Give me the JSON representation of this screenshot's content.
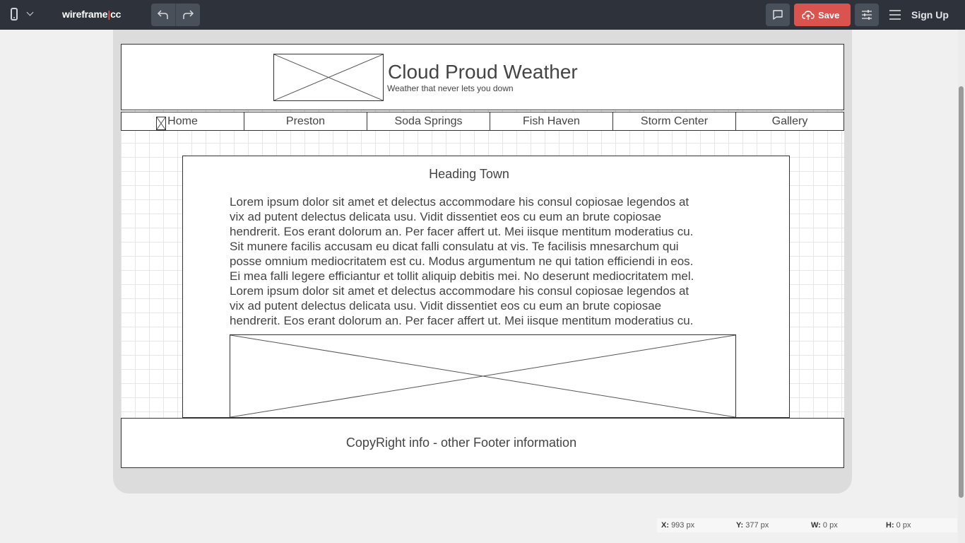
{
  "toolbar": {
    "device_icon": "phone-icon",
    "logo_main": "wireframe",
    "logo_pipe": "|",
    "logo_suffix": "cc",
    "undo_icon": "undo-icon",
    "redo_icon": "redo-icon",
    "comment_icon": "comment-icon",
    "save_label": "Save",
    "save_icon": "cloud-upload-icon",
    "settings_icon": "sliders-icon",
    "menu_icon": "hamburger-icon",
    "signup_label": "Sign Up",
    "colors": {
      "bar": "#2d323b",
      "save": "#d9534f",
      "button": "#4a505a"
    }
  },
  "wireframe": {
    "site_title": "Cloud Proud Weather",
    "tagline": "Weather that never lets you down",
    "nav": [
      "Home",
      "Preston",
      "Soda Springs",
      "Fish Haven",
      "Storm Center",
      "Gallery"
    ],
    "heading": "Heading Town",
    "body_lines": [
      "Lorem ipsum dolor sit amet et delectus accommodare his consul copiosae legendos at",
      "vix ad putent delectus delicata usu. Vidit dissentiet eos cu eum an brute copiosae",
      "hendrerit. Eos erant dolorum an. Per facer affert ut. Mei iisque mentitum moderatius cu.",
      "Sit munere facilis accusam eu dicat falli consulatu at vis. Te facilisis mnesarchum qui",
      "posse omnium mediocritatem est cu. Modus argumentum ne qui tation efficiendi in eos.",
      "Ei mea falli legere efficiantur et tollit aliquip debitis mei. No deserunt mediocritatem mel.",
      "Lorem ipsum dolor sit amet et delectus accommodare his consul copiosae legendos at",
      "vix ad putent delectus delicata usu. Vidit dissentiet eos cu eum an brute copiosae",
      "hendrerit. Eos erant dolorum an. Per facer affert ut. Mei iisque mentitum moderatius cu."
    ],
    "footer": "CopyRight info - other Footer information"
  },
  "status": {
    "x_label": "X:",
    "x_value": "993 px",
    "y_label": "Y:",
    "y_value": "377 px",
    "w_label": "W:",
    "w_value": "0 px",
    "h_label": "H:",
    "h_value": "0 px"
  }
}
